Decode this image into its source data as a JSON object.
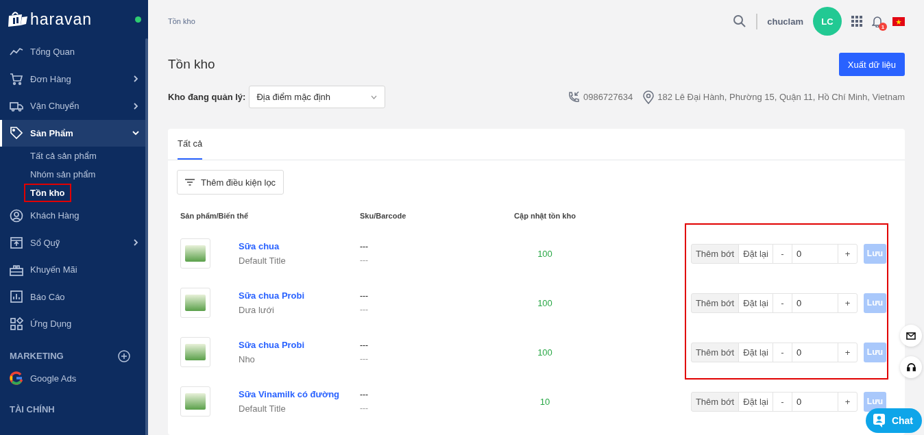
{
  "brand": {
    "name": "haravan",
    "online": true
  },
  "sidebar": {
    "items": [
      {
        "label": "Tổng Quan",
        "has_submenu": false,
        "expanded": false,
        "selected": false
      },
      {
        "label": "Đơn Hàng",
        "has_submenu": true,
        "expanded": false,
        "selected": false
      },
      {
        "label": "Vận Chuyển",
        "has_submenu": true,
        "expanded": false,
        "selected": false
      },
      {
        "label": "Sản Phẩm",
        "has_submenu": true,
        "expanded": true,
        "selected": true,
        "children": [
          {
            "label": "Tất cả sản phẩm",
            "selected": false,
            "highlighted": false
          },
          {
            "label": "Nhóm sản phẩm",
            "selected": false,
            "highlighted": false
          },
          {
            "label": "Tồn kho",
            "selected": true,
            "highlighted": true
          }
        ]
      },
      {
        "label": "Khách Hàng",
        "has_submenu": false,
        "expanded": false,
        "selected": false
      },
      {
        "label": "Sổ Quỹ",
        "has_submenu": true,
        "expanded": false,
        "selected": false
      },
      {
        "label": "Khuyến Mãi",
        "has_submenu": false,
        "expanded": false,
        "selected": false
      },
      {
        "label": "Báo Cáo",
        "has_submenu": false,
        "expanded": false,
        "selected": false
      },
      {
        "label": "Ứng Dụng",
        "has_submenu": false,
        "expanded": false,
        "selected": false
      }
    ],
    "sections": [
      {
        "title": "MARKETING",
        "items": [
          {
            "label": "Google Ads"
          }
        ]
      },
      {
        "title": "TÀI CHÍNH"
      }
    ]
  },
  "header": {
    "breadcrumb": "Tồn kho",
    "username": "chuclam",
    "avatar_initials": "LC",
    "notification_count": "1"
  },
  "page": {
    "title": "Tồn kho",
    "export_button": "Xuất dữ liệu",
    "warehouse_label": "Kho đang quản lý:",
    "warehouse_value": "Địa điểm mặc định",
    "phone": "0986727634",
    "address": "182 Lê Đại Hành, Phường 15, Quận 11, Hồ Chí Minh, Vietnam"
  },
  "card": {
    "tabs": [
      {
        "label": "Tất cả",
        "selected": true
      }
    ],
    "filter_button": "Thêm điều kiện lọc",
    "columns": [
      "Sản phẩm/Biến thể",
      "Sku/Barcode",
      "Cập nhật tồn kho"
    ],
    "rows": [
      {
        "name": "Sữa chua",
        "variant": "Default Title",
        "sku": "---",
        "barcode": "---",
        "quantity": "100",
        "mode_add": "Thêm bớt",
        "mode_reset": "Đặt lại",
        "add_selected": true,
        "minus": "-",
        "value": "0",
        "plus": "+",
        "save": "Lưu",
        "save_disabled": true,
        "highlighted": true
      },
      {
        "name": "Sữa chua Probi",
        "variant": "Dưa lưới",
        "sku": "---",
        "barcode": "---",
        "quantity": "100",
        "mode_add": "Thêm bớt",
        "mode_reset": "Đặt lại",
        "add_selected": true,
        "minus": "-",
        "value": "0",
        "plus": "+",
        "save": "Lưu",
        "save_disabled": true,
        "highlighted": true
      },
      {
        "name": "Sữa chua Probi",
        "variant": "Nho",
        "sku": "---",
        "barcode": "---",
        "quantity": "100",
        "mode_add": "Thêm bớt",
        "mode_reset": "Đặt lại",
        "add_selected": true,
        "minus": "-",
        "value": "0",
        "plus": "+",
        "save": "Lưu",
        "save_disabled": true,
        "highlighted": true
      },
      {
        "name": "Sữa Vinamilk có đường",
        "variant": "Default Title",
        "sku": "---",
        "barcode": "---",
        "quantity": "10",
        "mode_add": "Thêm bớt",
        "mode_reset": "Đặt lại",
        "add_selected": true,
        "minus": "-",
        "value": "0",
        "plus": "+",
        "save": "Lưu",
        "save_disabled": true,
        "highlighted": false
      }
    ]
  },
  "chat": {
    "label": "Chat"
  }
}
